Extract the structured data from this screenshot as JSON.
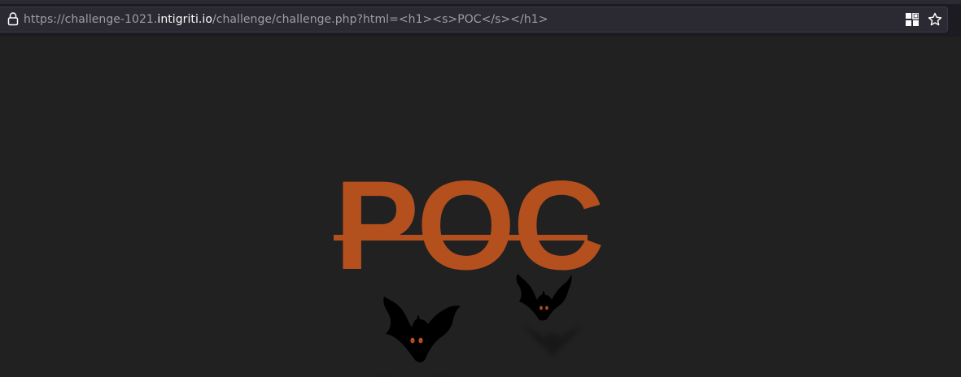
{
  "browser": {
    "url_prefix": "https://challenge-1021.",
    "url_host": "intigriti.io",
    "url_path": "/challenge/challenge.php?html=<h1><s>POC</s></h1>",
    "icons": [
      "lock-icon",
      "reader-view-icon",
      "bookmark-star-icon"
    ]
  },
  "page": {
    "heading": "POC",
    "heading_color": "#b44f1e",
    "background_color": "#212121",
    "decorations": [
      "bat-icon",
      "bat-icon"
    ]
  }
}
